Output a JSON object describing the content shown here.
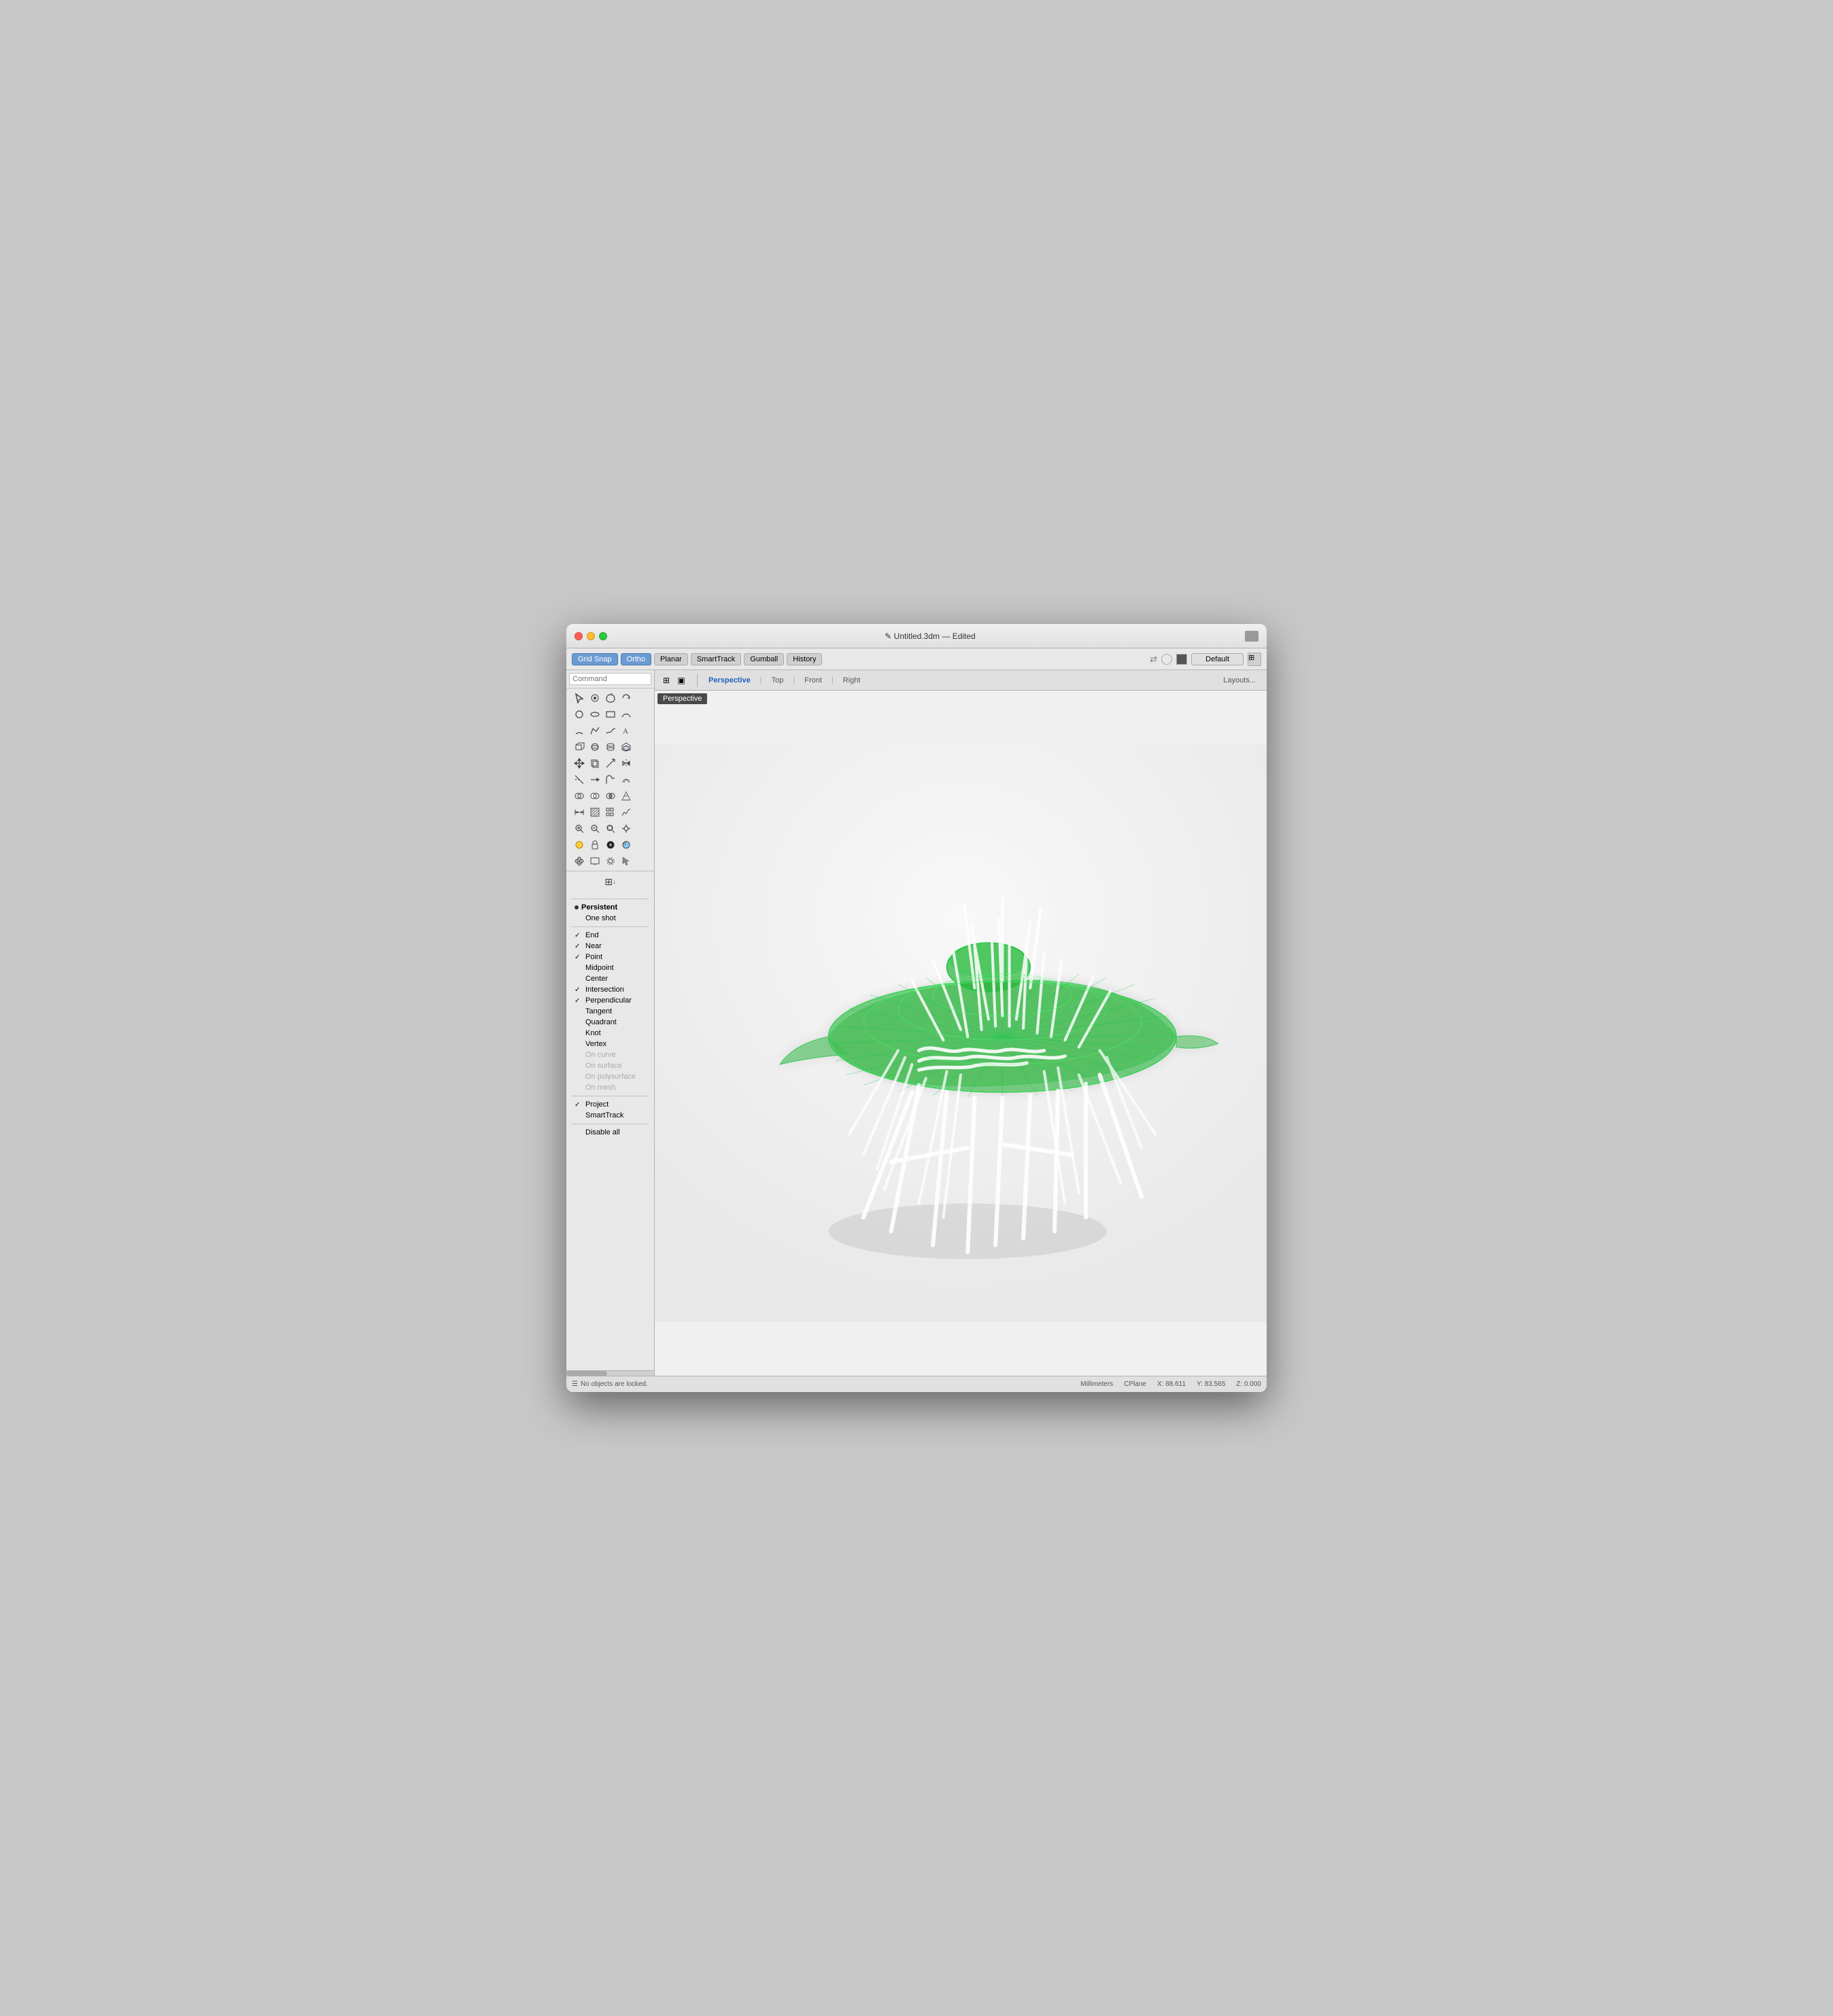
{
  "window": {
    "title": "✎ Untitled.3dm — Edited"
  },
  "toolbar": {
    "grid_snap": "Grid Snap",
    "ortho": "Ortho",
    "planar": "Planar",
    "smart_track": "SmartTrack",
    "gumball": "Gumball",
    "history": "History",
    "default_label": "Default",
    "layouts_label": "Layouts..."
  },
  "command": {
    "placeholder": "Command",
    "label": "Command"
  },
  "viewport_tabs": {
    "perspective": "Perspective",
    "top": "Top",
    "front": "Front",
    "right": "Right"
  },
  "viewport_label": "Perspective",
  "snap_items": [
    {
      "label": "Persistent",
      "checked": false,
      "group": true
    },
    {
      "label": "One shot",
      "checked": false,
      "group": false
    },
    {
      "label": "End",
      "checked": true,
      "disabled": false
    },
    {
      "label": "Near",
      "checked": true,
      "disabled": false
    },
    {
      "label": "Point",
      "checked": true,
      "disabled": false
    },
    {
      "label": "Midpoint",
      "checked": false,
      "disabled": false
    },
    {
      "label": "Center",
      "checked": false,
      "disabled": false
    },
    {
      "label": "Intersection",
      "checked": true,
      "disabled": false
    },
    {
      "label": "Perpendicular",
      "checked": true,
      "disabled": false
    },
    {
      "label": "Tangent",
      "checked": false,
      "disabled": false
    },
    {
      "label": "Quadrant",
      "checked": false,
      "disabled": false
    },
    {
      "label": "Knot",
      "checked": false,
      "disabled": false
    },
    {
      "label": "Vertex",
      "checked": false,
      "disabled": false
    },
    {
      "label": "On curve",
      "checked": false,
      "disabled": true
    },
    {
      "label": "On surface",
      "checked": false,
      "disabled": true
    },
    {
      "label": "On polysurface",
      "checked": false,
      "disabled": true
    },
    {
      "label": "On mesh",
      "checked": false,
      "disabled": true
    },
    {
      "label": "Project",
      "checked": true,
      "disabled": false
    },
    {
      "label": "SmartTrack",
      "checked": false,
      "disabled": false
    },
    {
      "label": "Disable all",
      "checked": false,
      "disabled": false
    }
  ],
  "statusbar": {
    "message": "No objects are locked.",
    "units": "Millimeters",
    "cplane": "CPlane",
    "x": "X: 88.611",
    "y": "Y: 83.565",
    "z": "Z: 0.000"
  },
  "tools": [
    "↖",
    "○",
    "↙",
    "↪",
    "⊙",
    "⊡",
    "⌒",
    "↗",
    "⊕",
    "⊞",
    "□",
    "↝",
    "△",
    "▽",
    "◁",
    "▷",
    "☐",
    "☑",
    "⊠",
    "◻",
    "☒",
    "☓",
    "⋯",
    "⊗",
    "▣",
    "⊘",
    "☷",
    "⊟",
    "☰",
    "⊞",
    "⊡",
    "⊢",
    "⊣",
    "⊤",
    "⊥",
    "⊦",
    "⊧",
    "⊨",
    "⊩",
    "⊪",
    "⊫",
    "⊬",
    "⊭",
    "⊮",
    "⊯",
    "⊰",
    "⊱"
  ]
}
